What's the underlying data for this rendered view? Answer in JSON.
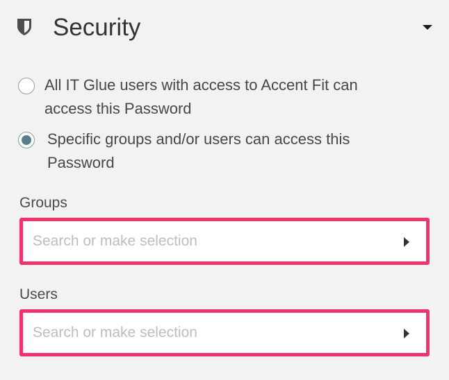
{
  "section": {
    "icon": "shield-icon",
    "title": "Security",
    "toggle_icon": "caret-down-icon"
  },
  "access_options": [
    {
      "label": "All IT Glue users with access to Accent Fit can access this Password",
      "selected": false
    },
    {
      "label": "Specific groups and/or users can access this Password",
      "selected": true
    }
  ],
  "groups": {
    "label": "Groups",
    "placeholder": "Search or make selection",
    "value": ""
  },
  "users": {
    "label": "Users",
    "placeholder": "Search or make selection",
    "value": ""
  },
  "colors": {
    "background": "#f2f2f2",
    "highlight_border": "#f0336b",
    "radio_selected": "#587f89",
    "placeholder": "#bdbdbd"
  }
}
